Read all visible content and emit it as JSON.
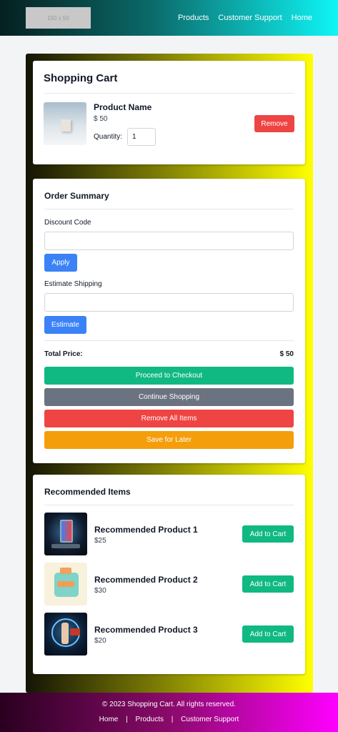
{
  "header": {
    "logo_text": "150 x 50",
    "nav": [
      "Products",
      "Customer Support",
      "Home"
    ]
  },
  "cart": {
    "title": "Shopping Cart",
    "item": {
      "name": "Product Name",
      "price": "$ 50",
      "quantity_label": "Quantity:",
      "quantity_value": "1",
      "remove_label": "Remove"
    }
  },
  "summary": {
    "title": "Order Summary",
    "discount_label": "Discount Code",
    "discount_value": "",
    "apply_label": "Apply",
    "shipping_label": "Estimate Shipping",
    "shipping_value": "",
    "estimate_label": "Estimate",
    "total_label": "Total Price:",
    "total_value": "$ 50",
    "checkout_label": "Proceed to Checkout",
    "continue_label": "Continue Shopping",
    "remove_all_label": "Remove All Items",
    "save_label": "Save for Later"
  },
  "recommended": {
    "title": "Recommended Items",
    "items": [
      {
        "name": "Recommended Product 1",
        "price": "$25",
        "button": "Add to Cart"
      },
      {
        "name": "Recommended Product 2",
        "price": "$30",
        "button": "Add to Cart"
      },
      {
        "name": "Recommended Product 3",
        "price": "$20",
        "button": "Add to Cart"
      }
    ]
  },
  "footer": {
    "copyright": "© 2023 Shopping Cart. All rights reserved.",
    "links": [
      "Home",
      "Products",
      "Customer Support"
    ],
    "separator": "|"
  },
  "colors": {
    "remove": "#ef4444",
    "primary": "#3b82f6",
    "checkout": "#10b981",
    "continue": "#6b7280",
    "save": "#f59e0b"
  }
}
